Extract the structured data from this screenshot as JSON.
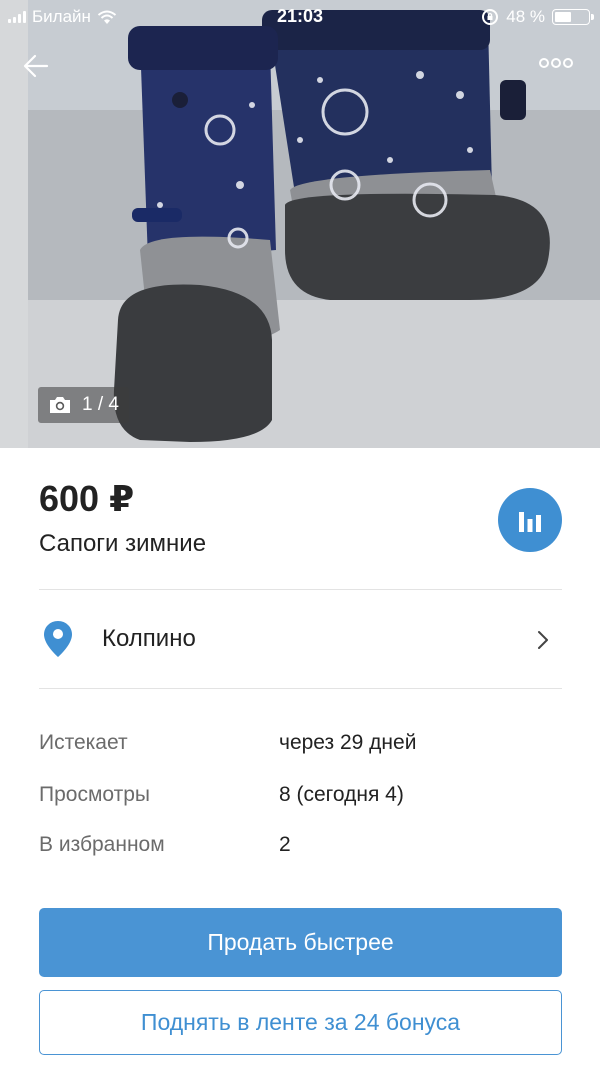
{
  "status_bar": {
    "carrier": "Билайн",
    "time": "21:03",
    "battery_percent": "48 %",
    "battery_level": 0.48
  },
  "hero": {
    "photo_subject": "winter boots",
    "photo_counter": "1 / 4"
  },
  "listing": {
    "price": "600 ₽",
    "title": "Сапоги зимние",
    "location": "Колпино"
  },
  "details": [
    {
      "label": "Истекает",
      "value": "через 29 дней"
    },
    {
      "label": "Просмотры",
      "value": "8 (сегодня 4)"
    },
    {
      "label": "В избранном",
      "value": "2"
    }
  ],
  "actions": {
    "sell_faster": "Продать быстрее",
    "raise_in_feed": "Поднять в ленте за 24 бонуса"
  },
  "icons": {
    "back": "arrow-left-icon",
    "more": "more-dots-icon",
    "camera": "camera-icon",
    "stats": "bar-chart-icon",
    "location": "location-pin-icon",
    "chevron": "chevron-right-icon"
  },
  "colors": {
    "accent": "#4a94d4",
    "pin": "#3f8fd2"
  }
}
